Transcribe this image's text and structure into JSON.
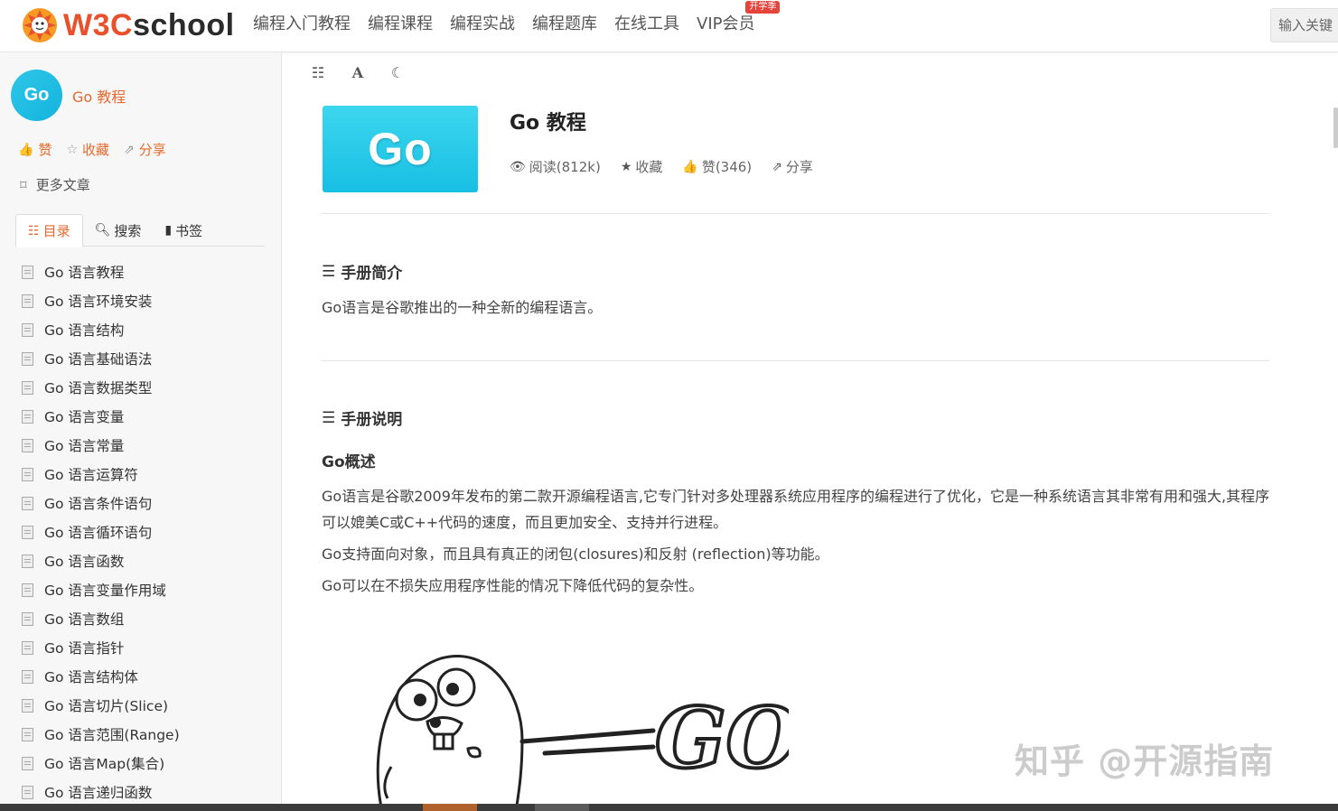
{
  "header": {
    "logo_text_w3c": "W3C",
    "logo_text_school": "school",
    "nav": [
      "编程入门教程",
      "编程课程",
      "编程实战",
      "编程题库",
      "在线工具",
      "VIP会员"
    ],
    "vip_badge": "开学季",
    "search_placeholder": "输入关键"
  },
  "sidebar": {
    "book_avatar": "Go",
    "book_title": "Go 教程",
    "actions": {
      "like": "赞",
      "favorite": "收藏",
      "share": "分享"
    },
    "more_articles": "更多文章",
    "tabs": {
      "toc": "目录",
      "search": "搜索",
      "bookmark": "书签"
    },
    "toc_items": [
      "Go 语言教程",
      "Go 语言环境安装",
      "Go 语言结构",
      "Go 语言基础语法",
      "Go 语言数据类型",
      "Go 语言变量",
      "Go 语言常量",
      "Go 语言运算符",
      "Go 语言条件语句",
      "Go 语言循环语句",
      "Go 语言函数",
      "Go 语言变量作用域",
      "Go 语言数组",
      "Go 语言指针",
      "Go 语言结构体",
      "Go 语言切片(Slice)",
      "Go 语言范围(Range)",
      "Go 语言Map(集合)",
      "Go 语言递归函数"
    ]
  },
  "main": {
    "cover_text": "Go",
    "title": "Go 教程",
    "meta": {
      "reads": "阅读(812k)",
      "favorite": "收藏",
      "likes": "赞(346)",
      "share": "分享"
    },
    "section1_title": "手册简介",
    "section1_text": "Go语言是谷歌推出的一种全新的编程语言。",
    "section2_title": "手册说明",
    "subhead": "Go概述",
    "para1": "Go语言是谷歌2009年发布的第二款开源编程语言,它专门针对多处理器系统应用程序的编程进行了优化，它是一种系统语言其非常有用和强大,其程序可以媲美C或C++代码的速度，而且更加安全、支持并行进程。",
    "para2": "Go支持面向对象，而且具有真正的闭包(closures)和反射 (reflection)等功能。",
    "para3": "Go可以在不损失应用程序性能的情况下降低代码的复杂性。",
    "gopher_text": "GO",
    "watermark": "知乎 @开源指南"
  },
  "colors": {
    "accent": "#e8692c",
    "logo_red": "#e8512c",
    "cover_cyan": "#18bfe3"
  },
  "icons": [
    "logo-icon",
    "thumbs-up-icon",
    "star-icon",
    "share-icon",
    "bookmark-outline-icon",
    "list-icon",
    "search-icon",
    "bookmark-icon",
    "document-icon",
    "font-icon",
    "moon-icon",
    "eye-icon",
    "hamburger-icon"
  ]
}
